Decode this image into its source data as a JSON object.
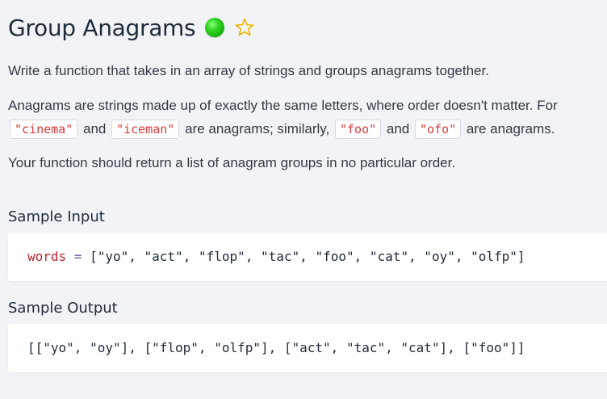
{
  "problem": {
    "title": "Group Anagrams",
    "difficulty_color": "#22c91a",
    "favorite_icon": "star-outline-icon",
    "paragraphs": {
      "p1": "Write a function that takes in an array of strings and groups anagrams together.",
      "p2_line1": "Anagrams are strings made up of exactly the same letters, where order doesn't matter. For",
      "p2_code1": "\"cinema\"",
      "p2_and1": "and",
      "p2_code2": "\"iceman\"",
      "p2_mid": "are anagrams; similarly,",
      "p2_code3": "\"foo\"",
      "p2_and2": "and",
      "p2_code4": "\"ofo\"",
      "p2_end": "are anagrams.",
      "p3": "Your function should return a list of anagram groups in no particular order."
    }
  },
  "sample_input": {
    "heading": "Sample Input",
    "var_name": "words",
    "operator": "=",
    "value": "[\"yo\", \"act\", \"flop\", \"tac\", \"foo\", \"cat\", \"oy\", \"olfp\"]"
  },
  "sample_output": {
    "heading": "Sample Output",
    "value": "[[\"yo\", \"oy\"], [\"flop\", \"olfp\"], [\"act\", \"tac\", \"cat\"], [\"foo\"]]"
  }
}
